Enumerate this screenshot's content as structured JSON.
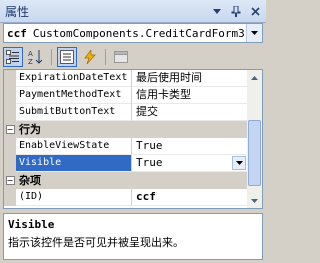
{
  "window": {
    "title": "属性"
  },
  "selector": {
    "name": "ccf",
    "type": "CustomComponents.CreditCardForm3"
  },
  "grid": {
    "rows": [
      {
        "kind": "property",
        "name": "ExpirationDateText",
        "value": "最后使用时间",
        "selected": false
      },
      {
        "kind": "property",
        "name": "PaymentMethodText",
        "value": "信用卡类型",
        "selected": false
      },
      {
        "kind": "property",
        "name": "SubmitButtonText",
        "value": "提交",
        "selected": false
      },
      {
        "kind": "category",
        "name": "行为"
      },
      {
        "kind": "property",
        "name": "EnableViewState",
        "value": "True",
        "selected": false
      },
      {
        "kind": "property",
        "name": "Visible",
        "value": "True",
        "selected": true
      },
      {
        "kind": "category",
        "name": "杂项"
      },
      {
        "kind": "property",
        "name": "(ID)",
        "value": "ccf",
        "selected": false,
        "bold": true
      }
    ]
  },
  "description": {
    "title": "Visible",
    "text": "指示该控件是否可见并被呈现出来。"
  },
  "colors": {
    "selection": "#316ac5",
    "category_bg": "#d4d0c8",
    "title_text": "#1f3a6a"
  },
  "icons": [
    "pin-icon",
    "close-icon",
    "categorized-icon",
    "alphabetical-icon",
    "properties-icon",
    "events-icon",
    "property-pages-icon"
  ]
}
